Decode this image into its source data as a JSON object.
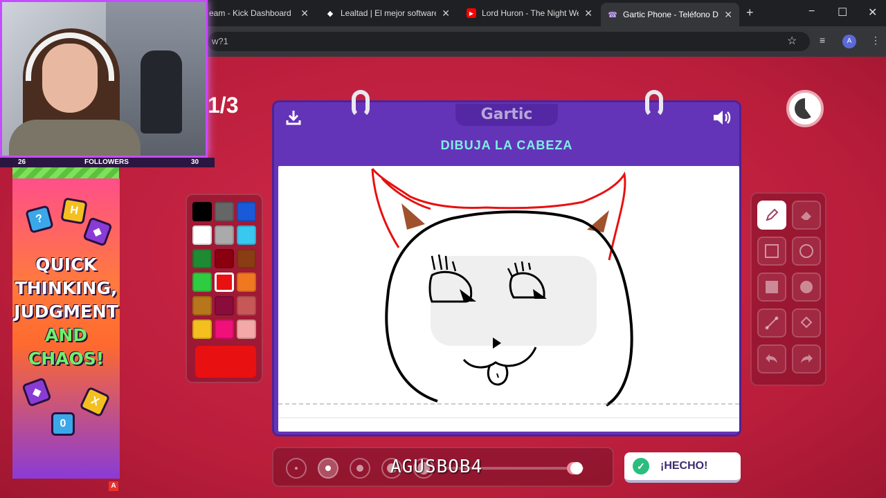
{
  "browser": {
    "tabs": [
      {
        "title": "eam - Kick Dashboard",
        "icon": "kick-favicon",
        "active": false
      },
      {
        "title": "Lealtad | El mejor software",
        "icon": "lealtad-favicon",
        "active": false
      },
      {
        "title": "Lord Huron - The Night We",
        "icon": "youtube-favicon",
        "active": false
      },
      {
        "title": "Gartic Phone - Teléfono De",
        "icon": "gartic-favicon",
        "active": true
      }
    ],
    "new_tab": "+",
    "url": "w?1",
    "window_controls": {
      "minimize": "−",
      "maximize": "☐",
      "close": "✕"
    },
    "account_initial": "A"
  },
  "game": {
    "round": "1/3",
    "logo": "Gartic",
    "prompt": "DIBUJA LA CABEZA",
    "done_label": "¡HECHO!",
    "palette": {
      "colors": [
        "#000000",
        "#666666",
        "#1a5ad8",
        "#ffffff",
        "#aaaaaa",
        "#38c8f0",
        "#1e8a32",
        "#8b0010",
        "#8a3c12",
        "#2ecc40",
        "#e81010",
        "#f07820",
        "#b8761c",
        "#8a0c3a",
        "#c85858",
        "#f4c020",
        "#f0107a",
        "#f4a8a8"
      ],
      "selected_index": 10,
      "current_color": "#e81010"
    },
    "tools": [
      "pencil-icon",
      "eraser-icon",
      "square-outline-icon",
      "circle-outline-icon",
      "square-fill-icon",
      "circle-fill-icon",
      "line-icon",
      "bucket-icon",
      "undo-icon",
      "redo-icon"
    ],
    "selected_tool": "pencil-icon",
    "brush_sizes": 5,
    "selected_size_index": 1,
    "opacity_level": 0.95
  },
  "stream": {
    "followers_label": "FOLLOWERS",
    "followers_current": "26",
    "followers_goal": "30",
    "promo_lines": [
      "QUICK",
      "THINKING,",
      "JUDGMENT",
      "AND",
      "CHAOS!"
    ],
    "badge": "A",
    "username": "AGUSBOB4"
  }
}
